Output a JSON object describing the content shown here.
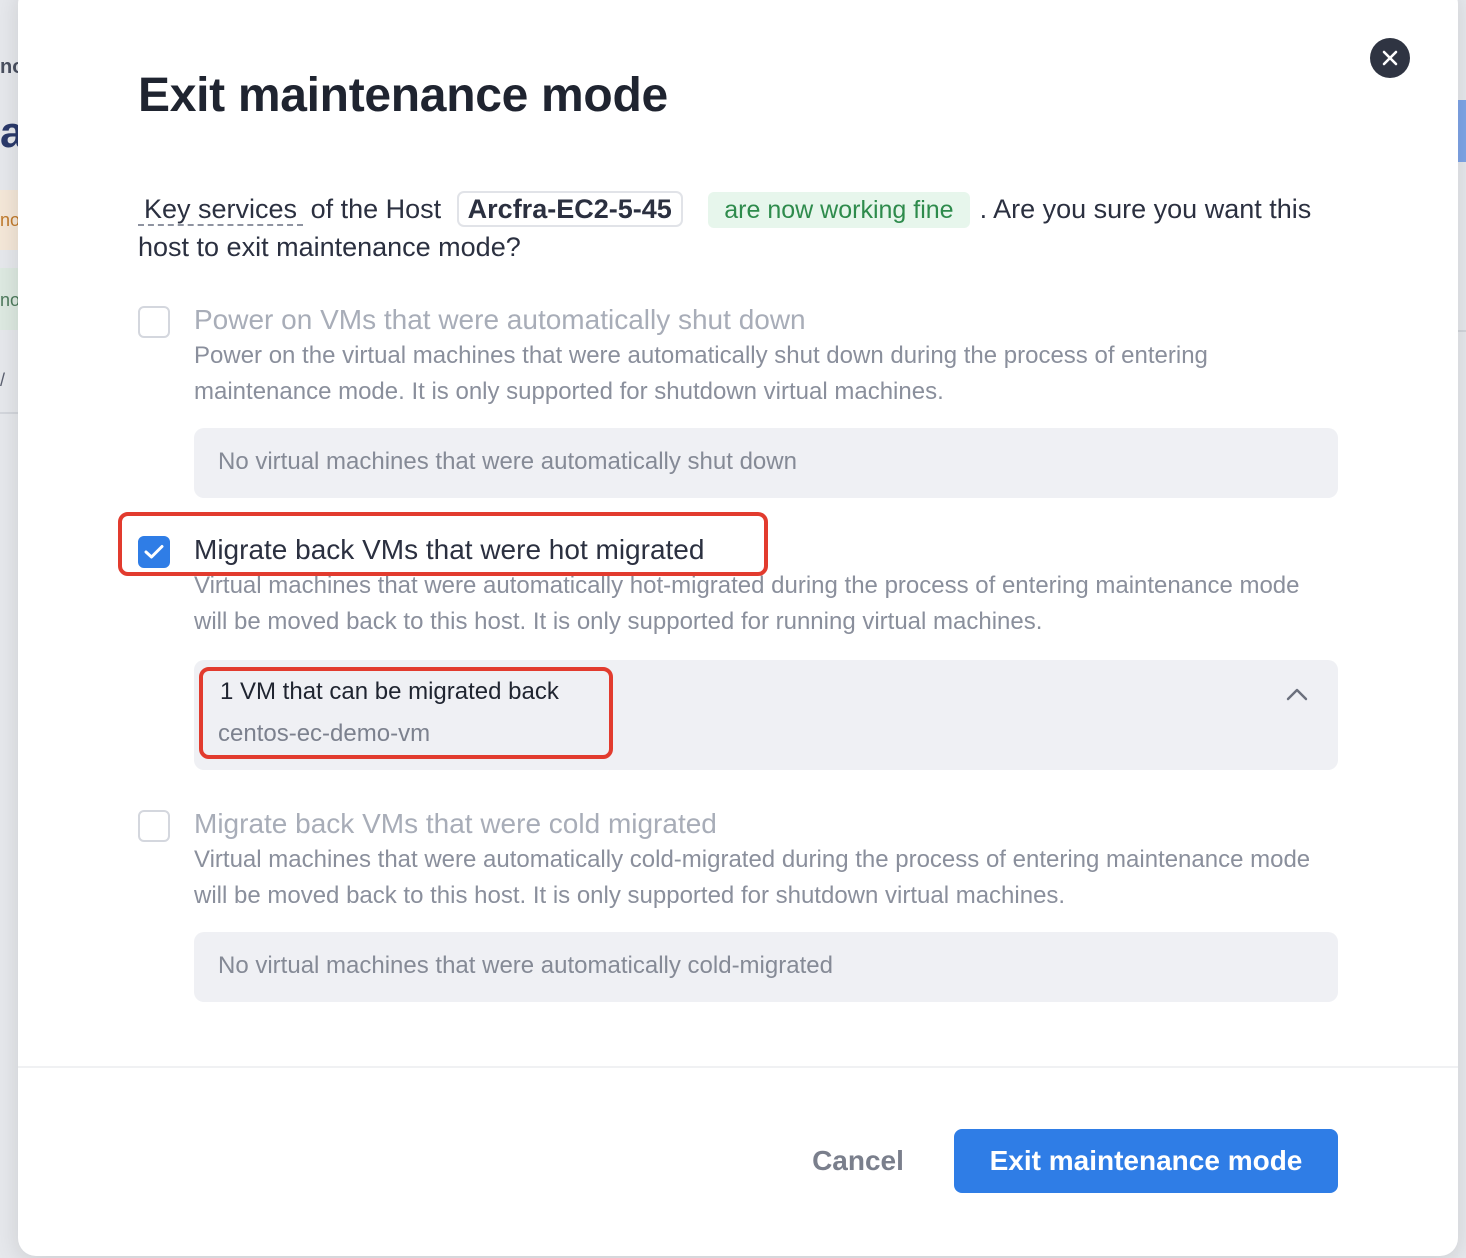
{
  "background": {
    "fragment_1": "no",
    "fragment_2": "a",
    "fragment_3": "no",
    "fragment_4": "no",
    "fragment_5": "/"
  },
  "dialog": {
    "title": "Exit maintenance mode",
    "close_icon": "close-icon",
    "intro": {
      "key_services": "Key services",
      "of_the_host": "of the Host",
      "host_name": "Arcfra-EC2-5-45",
      "status": "are now working fine",
      "question": ". Are you sure you want this host to exit maintenance mode?"
    },
    "options": [
      {
        "label": "Power on VMs that were automatically shut down",
        "checked": false,
        "description": "Power on the virtual machines that were automatically shut down during the process of entering maintenance mode. It is only supported for shutdown virtual machines.",
        "empty_text": "No virtual machines that were automatically shut down"
      },
      {
        "label": "Migrate back VMs that were hot migrated",
        "checked": true,
        "description": "Virtual machines that were automatically hot-migrated during the process of entering maintenance mode will be moved back to this host. It is only supported for running virtual machines.",
        "vm_count_text": "1 VM that can be migrated back",
        "vm_names": [
          "centos-ec-demo-vm"
        ],
        "expanded": true,
        "icon": "chevron-up-icon"
      },
      {
        "label": "Migrate back VMs that were cold migrated",
        "checked": false,
        "description": "Virtual machines that were automatically cold-migrated during the process of entering maintenance mode will be moved back to this host. It is only supported for shutdown virtual machines.",
        "empty_text": "No virtual machines that were automatically cold-migrated"
      }
    ],
    "footer": {
      "cancel_label": "Cancel",
      "confirm_label": "Exit maintenance mode"
    }
  },
  "colors": {
    "primary": "#2f7de6",
    "success_text": "#2e8b4c",
    "success_bg": "#e7f6ec",
    "highlight": "#e23b2e",
    "close_bg": "#2f3442"
  }
}
